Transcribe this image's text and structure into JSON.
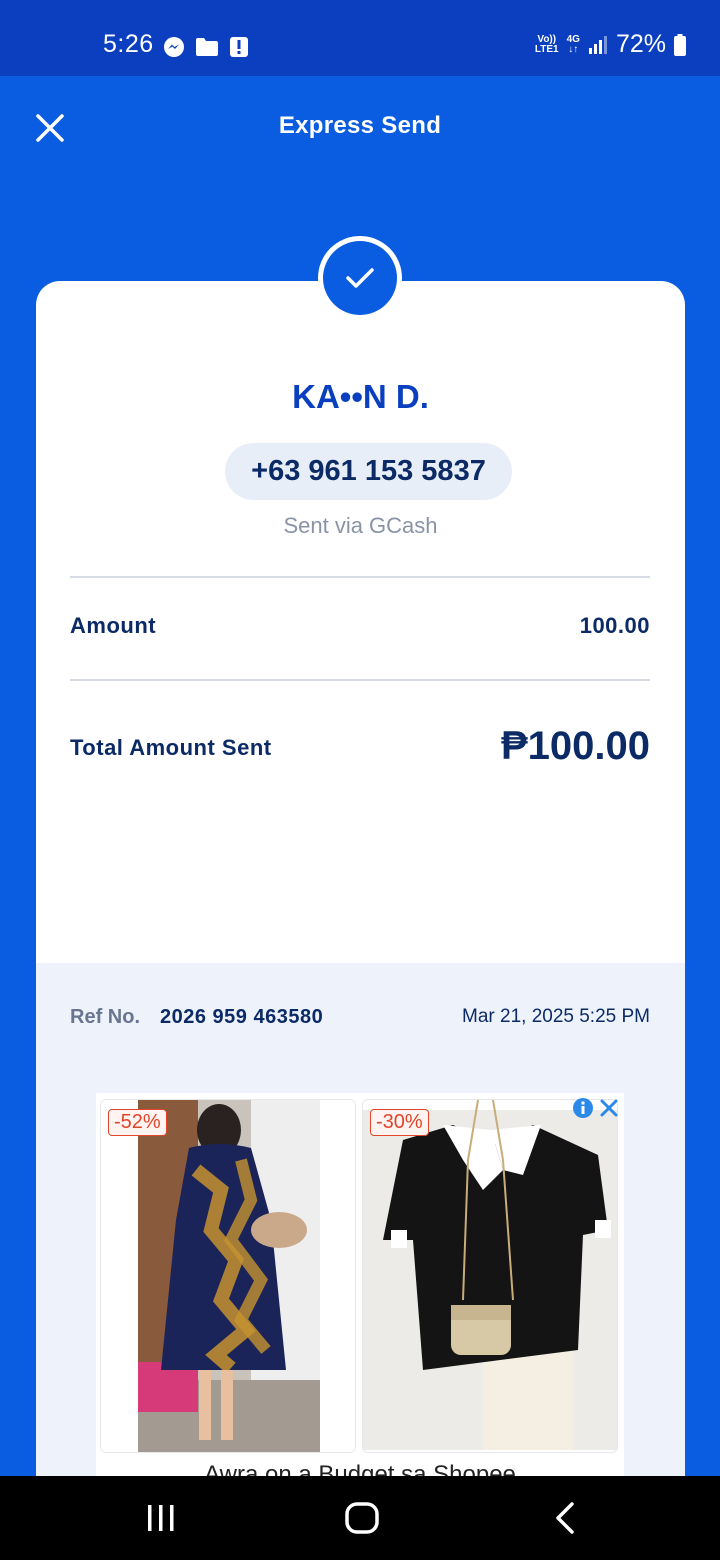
{
  "status_bar": {
    "time": "5:26",
    "network_top": "Vo))",
    "network_bottom": "LTE1",
    "network_type": "4G",
    "battery": "72%"
  },
  "header": {
    "title": "Express Send",
    "close_icon": "close-icon"
  },
  "receipt": {
    "recipient_name": "KA••N D.",
    "phone": "+63 961 153 5837",
    "sent_via": "Sent via GCash",
    "amount_label": "Amount",
    "amount_value": "100.00",
    "total_label": "Total Amount Sent",
    "total_value": "₱100.00",
    "ref_label": "Ref No.",
    "ref_number": "2026 959 463580",
    "date": "Mar 21, 2025 5:25 PM"
  },
  "ad": {
    "items": [
      {
        "discount": "-52%"
      },
      {
        "discount": "-30%"
      }
    ],
    "caption": "Awra on a Budget sa Shopee"
  },
  "colors": {
    "brand_blue": "#0a5ce0",
    "status_blue": "#0b3fc0",
    "navy_text": "#0b2a66",
    "discount_red": "#e0452b"
  }
}
